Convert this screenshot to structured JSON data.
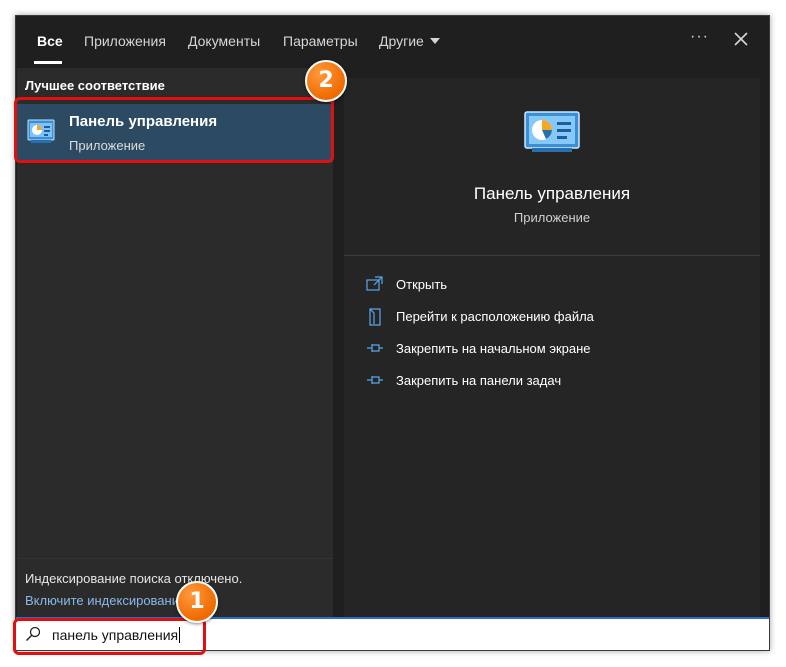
{
  "tabs": [
    "Все",
    "Приложения",
    "Документы",
    "Параметры",
    "Другие"
  ],
  "more_label": "···",
  "best_match": {
    "section_title": "Лучшее соответствие",
    "title": "Панель управления",
    "subtitle": "Приложение"
  },
  "index": {
    "notice": "Индексирование поиска отключено.",
    "link": "Включите индексирование"
  },
  "details": {
    "title": "Панель управления",
    "subtitle": "Приложение",
    "actions": [
      "Открыть",
      "Перейти к расположению файла",
      "Закрепить на начальном экране",
      "Закрепить на панели задач"
    ]
  },
  "search": {
    "value": "панель управления"
  },
  "badges": [
    "1",
    "2"
  ],
  "colors": {
    "accent": "#2a6fcf",
    "highlight": "#e01010",
    "badge": "#ef6a00",
    "selected": "#2c4a61"
  },
  "icons": [
    "control-panel-icon",
    "open-icon",
    "file-location-icon",
    "pin-start-icon",
    "pin-taskbar-icon",
    "search-icon",
    "close-icon",
    "chevron-down-icon"
  ]
}
